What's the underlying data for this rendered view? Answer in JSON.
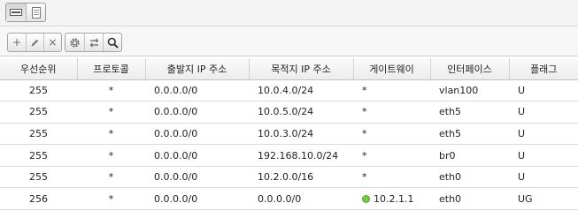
{
  "view_toggle": {
    "list_icon": "list-view-icon",
    "detail_icon": "detail-view-icon"
  },
  "toolbar": {
    "add": "+",
    "edit_icon": "pencil-icon",
    "delete": "×",
    "settings_icon": "gear-icon",
    "swap_icon": "swap-icon",
    "search_icon": "search-icon"
  },
  "table": {
    "columns": [
      "우선순위",
      "프로토콜",
      "출발지 IP 주소",
      "목적지 IP 주소",
      "게이트웨이",
      "인터페이스",
      "플래그"
    ],
    "rows": [
      [
        "255",
        "*",
        "0.0.0.0/0",
        "10.0.4.0/24",
        "*",
        "vlan100",
        "U"
      ],
      [
        "255",
        "*",
        "0.0.0.0/0",
        "10.0.5.0/24",
        "*",
        "eth5",
        "U"
      ],
      [
        "255",
        "*",
        "0.0.0.0/0",
        "10.0.3.0/24",
        "*",
        "eth5",
        "U"
      ],
      [
        "255",
        "*",
        "0.0.0.0/0",
        "192.168.10.0/24",
        "*",
        "br0",
        "U"
      ],
      [
        "255",
        "*",
        "0.0.0.0/0",
        "10.2.0.0/16",
        "*",
        "eth0",
        "U"
      ],
      [
        "256",
        "*",
        "0.0.0.0/0",
        "0.0.0.0/0",
        "10.2.1.1",
        "eth0",
        "UG"
      ]
    ],
    "gateway_status_color": "#77c74a"
  }
}
